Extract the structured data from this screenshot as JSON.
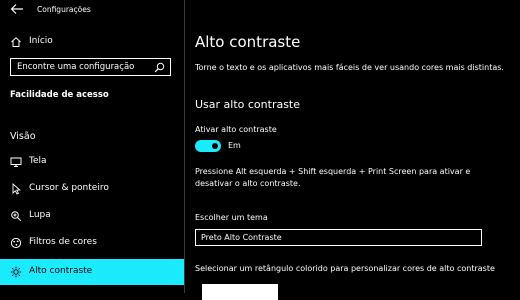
{
  "window": {
    "title": "Configurações"
  },
  "sidebar": {
    "home_label": "Início",
    "search_placeholder": "Encontre uma configuração",
    "section_title": "Facilidade de acesso",
    "group_header": "Visão",
    "items": [
      {
        "label": "Tela",
        "icon": "display-icon"
      },
      {
        "label": "Cursor & ponteiro",
        "icon": "cursor-icon"
      },
      {
        "label": "Lupa",
        "icon": "magnifier-icon"
      },
      {
        "label": "Filtros de cores",
        "icon": "color-filter-icon"
      },
      {
        "label": "Alto contraste",
        "icon": "brightness-icon",
        "active": true
      }
    ]
  },
  "main": {
    "title": "Alto contraste",
    "description": "Torne o texto e os aplicativos mais fáceis de ver usando cores mais distintas.",
    "subtitle": "Usar alto contraste",
    "toggle": {
      "label": "Ativar alto contraste",
      "state": "Em",
      "on": true
    },
    "hint": "Pressione Alt esquerda + Shift esquerda + Print Screen para ativar e desativar o alto contraste.",
    "theme": {
      "label": "Escolher um tema",
      "value": "Preto Alto Contraste"
    },
    "rect_label": "Selecionar um retângulo colorido para personalizar cores de alto contraste"
  },
  "colors": {
    "accent": "#1aebff",
    "background": "#000000",
    "text": "#ffffff"
  }
}
